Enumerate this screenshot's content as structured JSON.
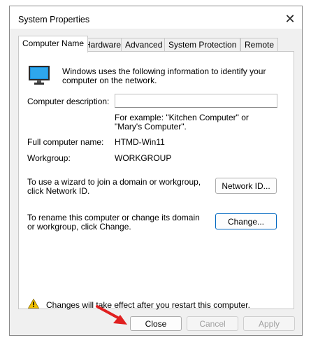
{
  "window": {
    "title": "System Properties",
    "close_glyph": "✕"
  },
  "tabs": [
    "Computer Name",
    "Hardware",
    "Advanced",
    "System Protection",
    "Remote"
  ],
  "computer_name": {
    "intro": "Windows uses the following information to identify your computer on the network.",
    "description_label": "Computer description:",
    "description_value": "",
    "example": "For example: \"Kitchen Computer\" or \"Mary's Computer\".",
    "full_name_label": "Full computer name:",
    "full_name_value": "HTMD-Win11",
    "workgroup_label": "Workgroup:",
    "workgroup_value": "WORKGROUP",
    "network_id_text": "To use a wizard to join a domain or workgroup, click Network ID.",
    "network_id_button": "Network ID...",
    "rename_text": "To rename this computer or change its domain or workgroup, click Change.",
    "change_button": "Change...",
    "warning_text": "Changes will take effect after you restart this computer."
  },
  "footer": {
    "close": "Close",
    "cancel": "Cancel",
    "apply": "Apply"
  },
  "icons": {
    "computer": "monitor-icon",
    "warning": "warning-icon",
    "arrow": "red-arrow-annotation"
  },
  "colors": {
    "accent": "#0067c0",
    "arrow": "#e02020",
    "warning": "#f2c200"
  }
}
